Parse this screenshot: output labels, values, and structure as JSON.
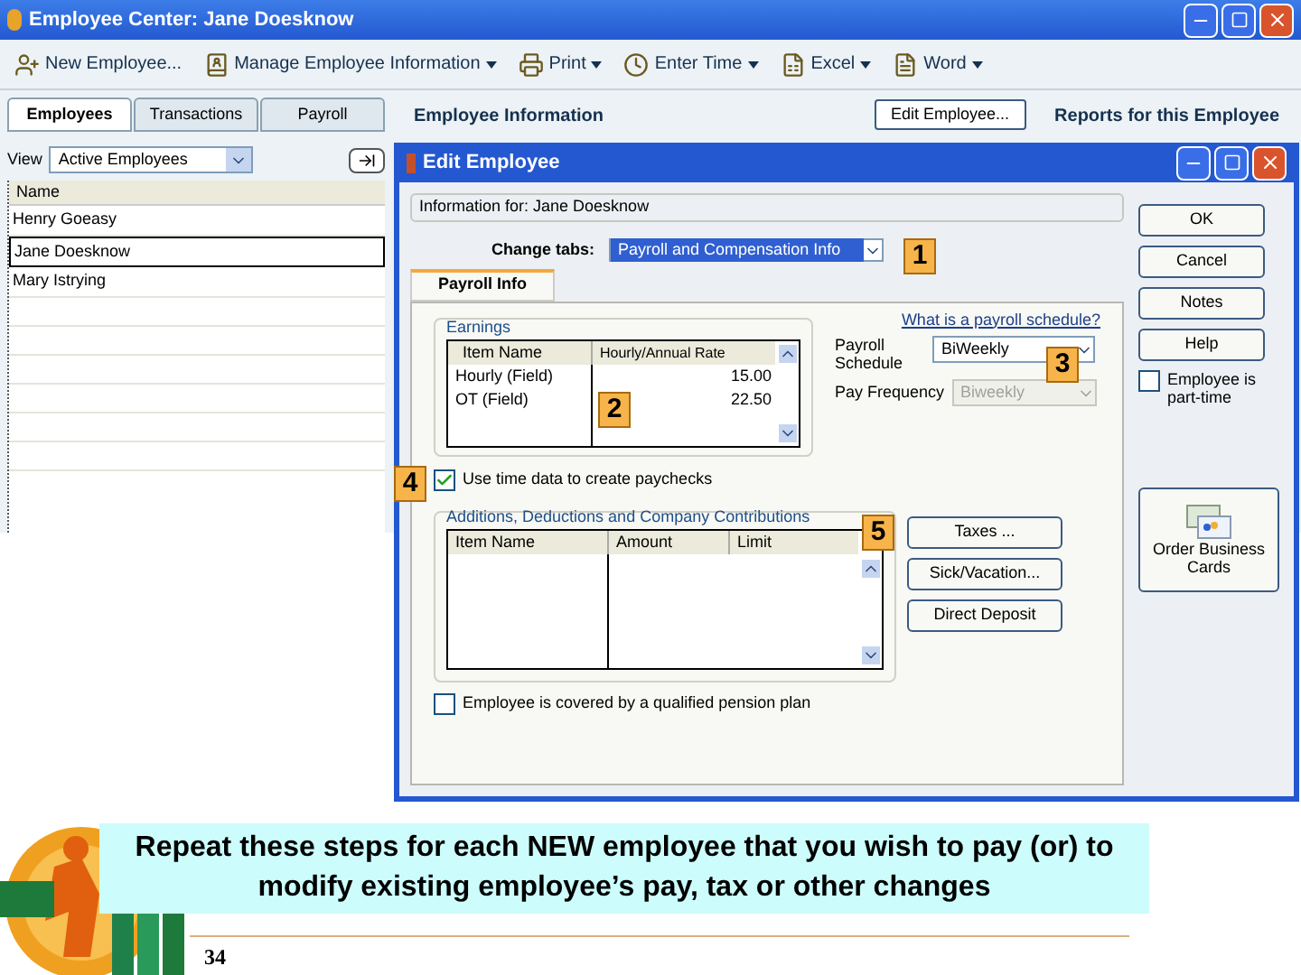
{
  "main_window": {
    "title": "Employee Center: Jane Doesknow",
    "toolbar": [
      {
        "label": "New Employee...",
        "dropdown": false
      },
      {
        "label": "Manage Employee Information",
        "dropdown": true
      },
      {
        "label": "Print",
        "dropdown": true
      },
      {
        "label": "Enter Time",
        "dropdown": true
      },
      {
        "label": "Excel",
        "dropdown": true
      },
      {
        "label": "Word",
        "dropdown": true
      }
    ],
    "tabs": [
      {
        "label": "Employees",
        "selected": true
      },
      {
        "label": "Transactions",
        "selected": false
      },
      {
        "label": "Payroll",
        "selected": false
      }
    ],
    "view": {
      "label": "View",
      "value": "Active Employees"
    },
    "list": {
      "column": "Name",
      "rows": [
        {
          "name": "Henry Goeasy",
          "selected": false
        },
        {
          "name": "Jane Doesknow",
          "selected": true
        },
        {
          "name": "Mary Istrying",
          "selected": false
        }
      ]
    },
    "info_header": "Employee Information",
    "edit_button": "Edit Employee...",
    "reports_header": "Reports for this Employee"
  },
  "dialog": {
    "title": "Edit Employee",
    "info": "Information for: Jane Doesknow",
    "change_tabs_label": "Change tabs:",
    "change_tabs_value": "Payroll and Compensation Info",
    "tab": "Payroll Info",
    "earnings": {
      "title": "Earnings",
      "columns": [
        "Item Name",
        "Hourly/Annual Rate"
      ],
      "rows": [
        {
          "item": "Hourly (Field)",
          "rate": "15.00"
        },
        {
          "item": "OT (Field)",
          "rate": "22.50"
        }
      ]
    },
    "schedule_link": "What is a payroll schedule?",
    "schedule_label": "Payroll Schedule",
    "schedule_value": "BiWeekly",
    "frequency_label": "Pay Frequency",
    "frequency_value": "Biweekly",
    "frequency_disabled": true,
    "use_time_data": {
      "label": "Use time data to create paychecks",
      "checked": true
    },
    "additions": {
      "title": "Additions, Deductions and Company Contributions",
      "columns": [
        "Item Name",
        "Amount",
        "Limit"
      ]
    },
    "side_buttons": [
      "Taxes ...",
      "Sick/Vacation...",
      "Direct Deposit"
    ],
    "pension": {
      "label": "Employee is covered by a qualified pension plan",
      "checked": false
    },
    "buttons": [
      "OK",
      "Cancel",
      "Notes",
      "Help"
    ],
    "part_time": {
      "label": "Employee is part-time",
      "checked": false
    },
    "order_cards": "Order Business Cards",
    "callouts": [
      "1",
      "2",
      "3",
      "4",
      "5"
    ]
  },
  "caption": "Repeat these steps for each NEW employee that you wish to pay (or) to modify existing employee’s pay, tax or other changes",
  "page_number": "34"
}
